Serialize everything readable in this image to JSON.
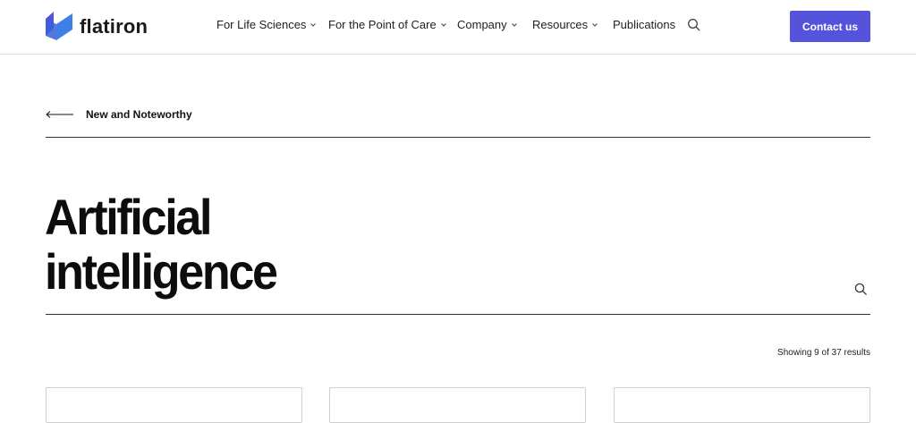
{
  "brand": {
    "name": "flatiron",
    "accent": "#5552db",
    "logo_icon": "flatiron-logo-icon"
  },
  "nav": {
    "items": [
      {
        "label": "For Life Sciences",
        "has_dropdown": true
      },
      {
        "label": "For the Point of Care",
        "has_dropdown": true
      },
      {
        "label": "Company",
        "has_dropdown": true
      },
      {
        "label": "Resources",
        "has_dropdown": true
      },
      {
        "label": "Publications",
        "has_dropdown": false
      }
    ],
    "search_icon": "search-icon",
    "contact_label": "Contact us"
  },
  "breadcrumb": {
    "back_label": "New and Noteworthy",
    "icon": "arrow-left-icon"
  },
  "page": {
    "title_line1": "Artificial",
    "title_line2": "intelligence",
    "search_icon": "search-icon",
    "results_text": "Showing 9 of 37 results"
  }
}
